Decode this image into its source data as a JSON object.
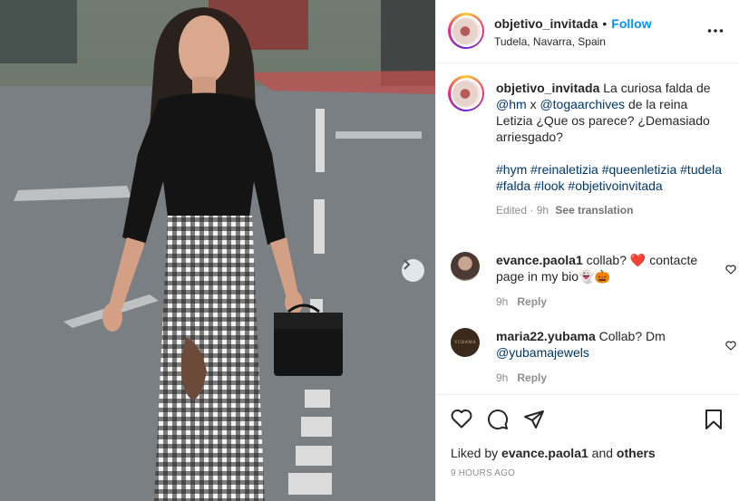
{
  "post": {
    "username": "objetivo_invitada",
    "separator": "•",
    "follow_label": "Follow",
    "location": "Tudela, Navarra, Spain",
    "caption": {
      "text_1": "La curiosa falda de",
      "mention_1": "@hm",
      "text_2": "x",
      "mention_2": "@togaarchives",
      "text_3": "de la reina Letizia ¿Que os parece? ¿Demasiado arriesgado?",
      "hashtags": [
        "#hym",
        "#reinaletizia",
        "#queenletizia",
        "#tudela",
        "#falda",
        "#look",
        "#objetivoinvitada"
      ]
    },
    "edited_label": "Edited · 9h",
    "see_translation": "See translation",
    "liked_by_prefix": "Liked by",
    "liked_by_user": "evance.paola1",
    "liked_by_and": "and",
    "liked_by_others": "others",
    "time_ago": "9 HOURS AGO"
  },
  "comments": [
    {
      "username": "evance.paola1",
      "text_1": "collab?",
      "emoji_1": "❤️",
      "text_2": "contacte page in my bio",
      "emoji_2": "👻🎃",
      "time": "9h",
      "reply_label": "Reply"
    },
    {
      "username": "maria22.yubama",
      "text_1": "Collab? Dm",
      "mention": "@yubamajewels",
      "avatar_text": "YUBAMA",
      "time": "9h",
      "reply_label": "Reply"
    }
  ],
  "icons": {
    "more": "more-options-icon",
    "next": "chevron-right-icon",
    "like": "heart-icon",
    "comment": "comment-icon",
    "share": "share-icon",
    "save": "bookmark-icon"
  },
  "colors": {
    "follow": "#0095f6",
    "link": "#00376b",
    "muted": "#8e8e8e",
    "heart_red": "#ed4956"
  }
}
